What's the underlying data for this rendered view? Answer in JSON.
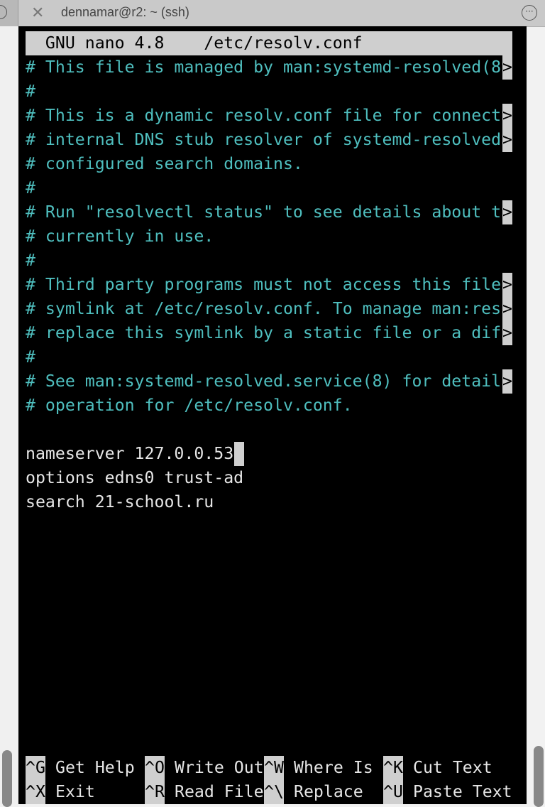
{
  "window": {
    "title": "dennamar@r2: ~ (ssh)",
    "close_icon": "close-icon",
    "more_icon": "more-icon"
  },
  "nano": {
    "header": "  GNU nano 4.8    /etc/resolv.conf",
    "lines": [
      {
        "text": "# This file is managed by man:systemd-resolved(8",
        "type": "comment",
        "truncated": true
      },
      {
        "text": "#",
        "type": "comment",
        "truncated": false
      },
      {
        "text": "# This is a dynamic resolv.conf file for connect",
        "type": "comment",
        "truncated": true
      },
      {
        "text": "# internal DNS stub resolver of systemd-resolved",
        "type": "comment",
        "truncated": true
      },
      {
        "text": "# configured search domains.",
        "type": "comment",
        "truncated": false
      },
      {
        "text": "#",
        "type": "comment",
        "truncated": false
      },
      {
        "text": "# Run \"resolvectl status\" to see details about t",
        "type": "comment",
        "truncated": true
      },
      {
        "text": "# currently in use.",
        "type": "comment",
        "truncated": false
      },
      {
        "text": "#",
        "type": "comment",
        "truncated": false
      },
      {
        "text": "# Third party programs must not access this file",
        "type": "comment",
        "truncated": true
      },
      {
        "text": "# symlink at /etc/resolv.conf. To manage man:res",
        "type": "comment",
        "truncated": true
      },
      {
        "text": "# replace this symlink by a static file or a dif",
        "type": "comment",
        "truncated": true
      },
      {
        "text": "#",
        "type": "comment",
        "truncated": false
      },
      {
        "text": "# See man:systemd-resolved.service(8) for detail",
        "type": "comment",
        "truncated": true
      },
      {
        "text": "# operation for /etc/resolv.conf.",
        "type": "comment",
        "truncated": false
      },
      {
        "text": "",
        "type": "plain",
        "truncated": false
      },
      {
        "text": "nameserver 127.0.0.53",
        "type": "plain",
        "truncated": false
      },
      {
        "text": "options edns0 trust-ad",
        "type": "plain",
        "truncated": false
      },
      {
        "text": "search 21-school.ru",
        "type": "plain",
        "truncated": false
      }
    ],
    "truncation_marker": ">",
    "shortcuts": [
      {
        "key": "^G",
        "label": "Get Help"
      },
      {
        "key": "^O",
        "label": "Write Out"
      },
      {
        "key": "^W",
        "label": "Where Is"
      },
      {
        "key": "^K",
        "label": "Cut Text"
      },
      {
        "key": "^X",
        "label": "Exit"
      },
      {
        "key": "^R",
        "label": "Read File"
      },
      {
        "key": "^\\",
        "label": "Replace"
      },
      {
        "key": "^U",
        "label": "Paste Text"
      }
    ]
  },
  "colors": {
    "comment": "#4fbfbf",
    "text": "#e6e6e6",
    "highlight": "#cfcfcf",
    "background": "#000000"
  }
}
